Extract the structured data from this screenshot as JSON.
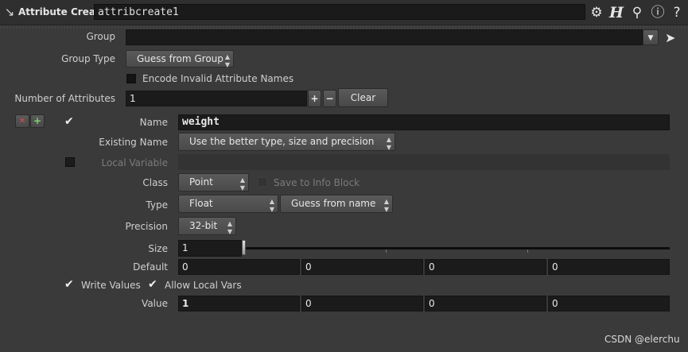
{
  "header": {
    "node_type": "Attribute Create",
    "node_name": "attribcreate1",
    "icons": [
      "node-tool-icon",
      "gear-icon",
      "houdini-help-icon",
      "search-icon",
      "info-icon",
      "help-icon"
    ]
  },
  "group": {
    "label": "Group",
    "value": ""
  },
  "group_type": {
    "label": "Group Type",
    "value": "Guess from Group"
  },
  "encode_invalid": {
    "label": "Encode Invalid Attribute Names",
    "checked": false
  },
  "num_attrs": {
    "label": "Number of Attributes",
    "value": "1",
    "plus": "+",
    "minus": "−",
    "clear": "Clear"
  },
  "multiparm": {
    "remove": "✕",
    "insert": "+"
  },
  "attribute": {
    "enabled": true,
    "name_label": "Name",
    "name_value": "weight",
    "existing_label": "Existing Name",
    "existing_value": "Use the better type, size and precision",
    "local_var_label": "Local Variable",
    "local_var_value": "",
    "class_label": "Class",
    "class_value": "Point",
    "save_info_label": "Save to Info Block",
    "type_label": "Type",
    "type_value": "Float",
    "type_info_value": "Guess from name",
    "precision_label": "Precision",
    "precision_value": "32-bit",
    "size_label": "Size",
    "size_value": "1",
    "default_label": "Default",
    "default_values": [
      "0",
      "0",
      "0",
      "0"
    ],
    "write_values_label": "Write Values",
    "write_values_checked": true,
    "allow_local_label": "Allow Local Vars",
    "allow_local_checked": true,
    "value_label": "Value",
    "values": [
      "1",
      "0",
      "0",
      "0"
    ]
  },
  "watermark": "CSDN @elerchu"
}
